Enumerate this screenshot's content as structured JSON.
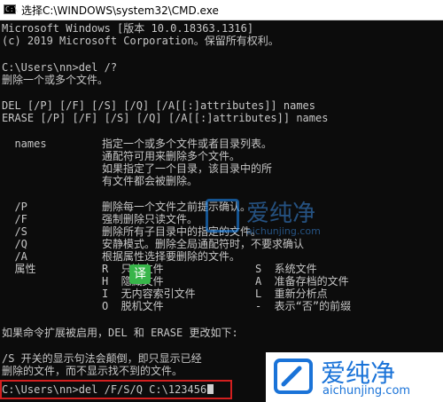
{
  "window": {
    "title": "选择C:\\WINDOWS\\system32\\CMD.exe",
    "icon_text": "C:\\"
  },
  "console": {
    "lines": [
      "Microsoft Windows [版本 10.0.18363.1316]",
      "(c) 2019 Microsoft Corporation。保留所有权利。",
      "C:\\Users\\nn>del /?",
      "删除一个或多个文件。",
      "DEL [/P] [/F] [/S] [/Q] [/A[[:]attributes]] names",
      "ERASE [/P] [/F] [/S] [/Q] [/A[[:]attributes]] names",
      "  names",
      "指定一个或多个文件或者目录列表。",
      "通配符可用来删除多个文件。",
      "如果指定了一个目录，该目录中的所",
      "有文件都会被删除。",
      "  /P",
      "删除每一个文件之前提示确认。",
      "  /F",
      "强制删除只读文件。",
      "  /S",
      "删除所有子目录中的指定的文件。",
      "  /Q",
      "安静模式。删除全局通配符时，不要求确认",
      "  /A",
      "根据属性选择要删除的文件。",
      "  属性",
      "R  只读文件",
      "S  系统文件",
      "H  隐藏文件",
      "A  准备存档的文件",
      "I  无内容索引文件",
      "L  重新分析点",
      "O  脱机文件",
      "-  表示“否”的前缀",
      "如果命令扩展被启用，DEL 和 ERASE 更改如下:",
      "/S 开关的显示句法会颠倒，即只显示已经",
      "删除的文件，而不显示找不到的文件。",
      "C:\\Users\\nn>del /F/S/Q C:\\123456"
    ]
  },
  "overlay": {
    "translate_label": "译"
  },
  "watermark": {
    "brand": "爱纯净",
    "url": "aichunjing.com"
  },
  "colors": {
    "console_bg": "#0c0c0c",
    "console_text": "#c7c7c7",
    "highlight_border": "#d31f1f",
    "watermark_blue": "#1a73d8",
    "translate_green": "#38b54a"
  }
}
